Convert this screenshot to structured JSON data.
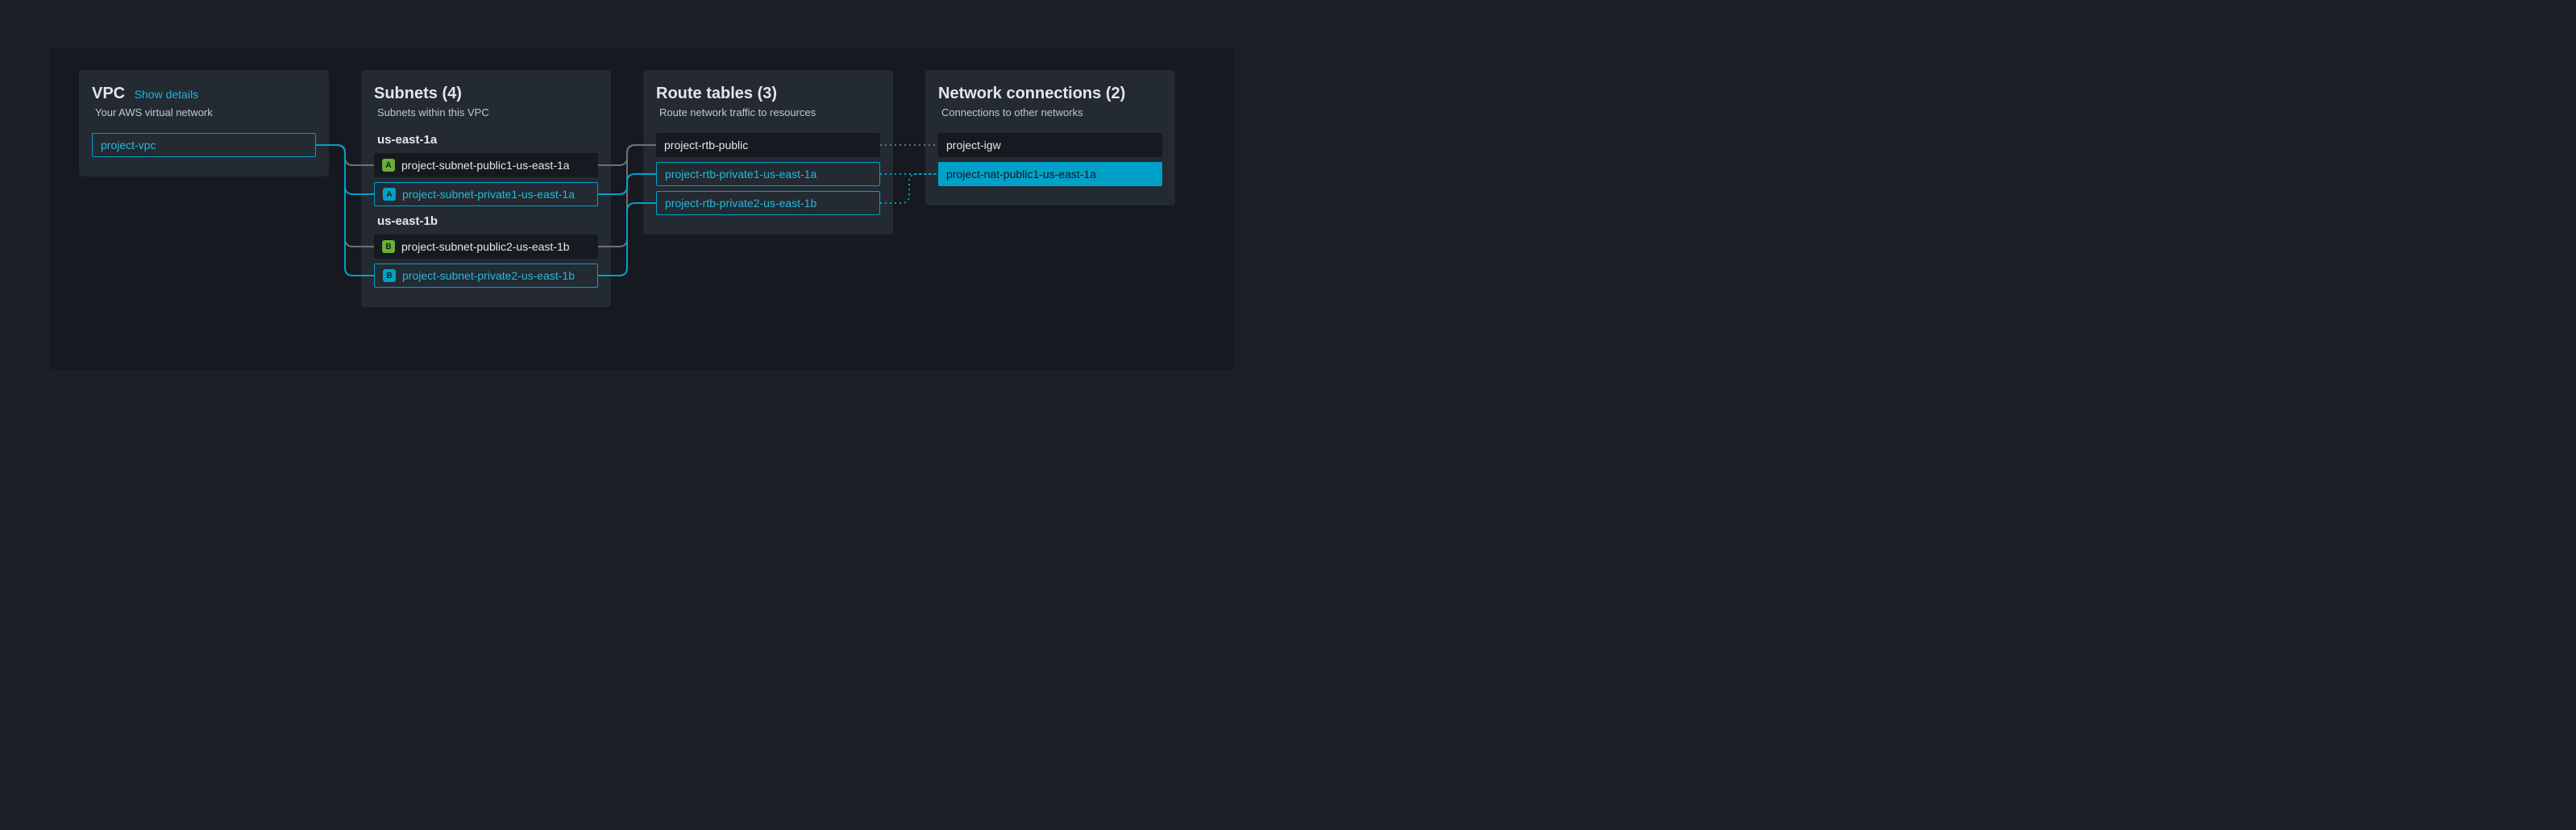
{
  "colors": {
    "teal": "#00a1c9",
    "tealText": "#2ab7d9",
    "dark": "#16191f",
    "panel": "#232a32",
    "gray": "#6b7177"
  },
  "vpc": {
    "title": "VPC",
    "show_details": "Show details",
    "subtitle": "Your AWS virtual network",
    "name": "project-vpc"
  },
  "subnets": {
    "title": "Subnets (4)",
    "subtitle": "Subnets within this VPC",
    "azs": [
      {
        "label": "us-east-1a",
        "items": [
          {
            "badge": "A",
            "badgeStyle": "green",
            "style": "dark",
            "name": "project-subnet-public1-us-east-1a"
          },
          {
            "badge": "A",
            "badgeStyle": "teal",
            "style": "outline-teal",
            "name": "project-subnet-private1-us-east-1a"
          }
        ]
      },
      {
        "label": "us-east-1b",
        "items": [
          {
            "badge": "B",
            "badgeStyle": "green",
            "style": "dark",
            "name": "project-subnet-public2-us-east-1b"
          },
          {
            "badge": "B",
            "badgeStyle": "teal",
            "style": "outline-teal",
            "name": "project-subnet-private2-us-east-1b"
          }
        ]
      }
    ]
  },
  "route_tables": {
    "title": "Route tables (3)",
    "subtitle": "Route network traffic to resources",
    "items": [
      {
        "style": "dark",
        "name": "project-rtb-public"
      },
      {
        "style": "outline-teal",
        "name": "project-rtb-private1-us-east-1a"
      },
      {
        "style": "outline-teal",
        "name": "project-rtb-private2-us-east-1b"
      }
    ]
  },
  "network_connections": {
    "title": "Network connections (2)",
    "subtitle": "Connections to other networks",
    "items": [
      {
        "style": "dark",
        "name": "project-igw"
      },
      {
        "style": "filled-teal",
        "name": "project-nat-public1-us-east-1a"
      }
    ]
  }
}
